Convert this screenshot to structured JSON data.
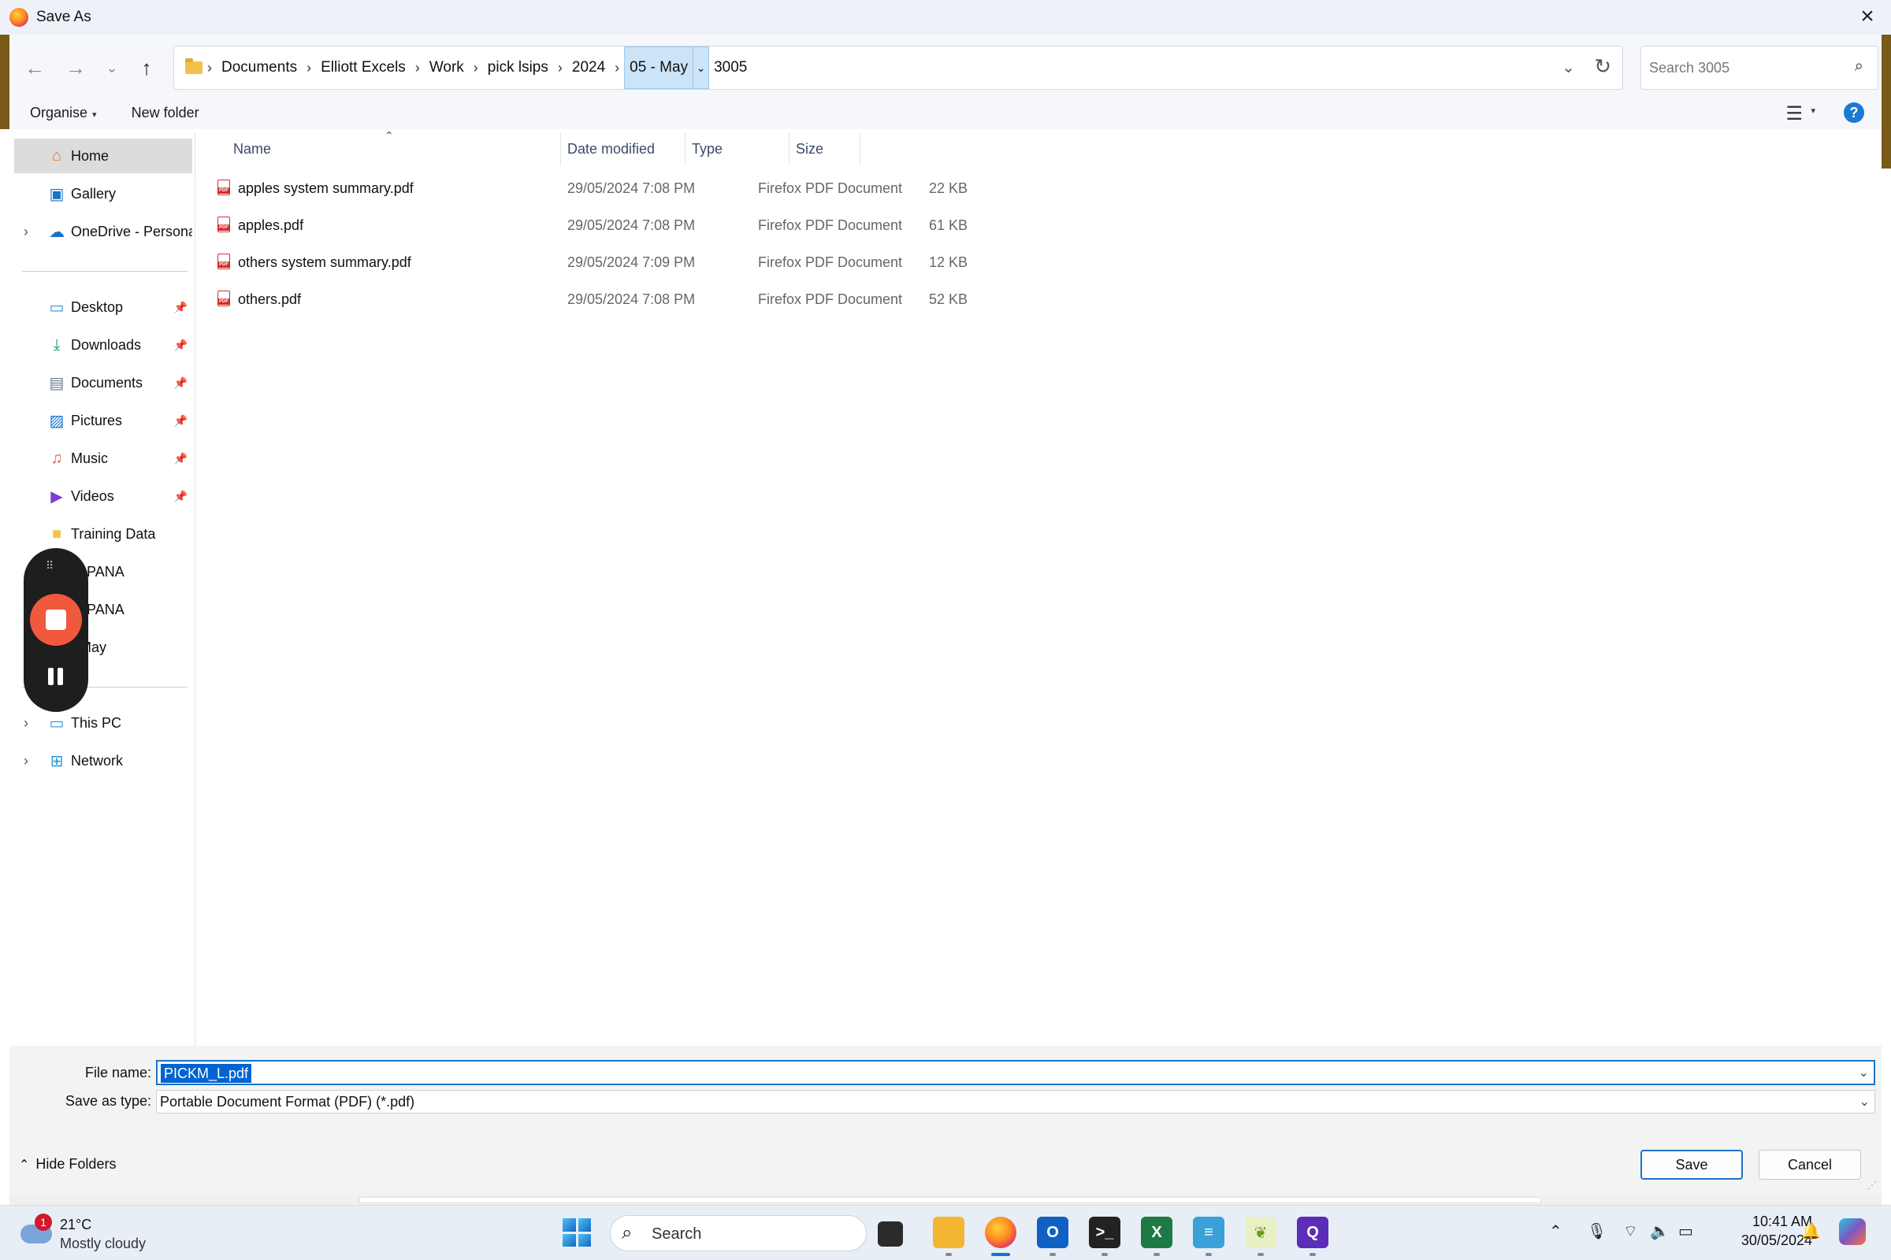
{
  "window": {
    "title": "Save As"
  },
  "address": {
    "crumbs": [
      "Documents",
      "Elliott Excels",
      "Work",
      "pick lsips",
      "2024"
    ],
    "selected_crumb": "05 - May",
    "tail": "3005"
  },
  "search": {
    "placeholder": "Search 3005"
  },
  "toolbar": {
    "organise_label": "Organise",
    "new_folder_label": "New folder"
  },
  "sidebar": {
    "items": [
      {
        "label": "Home"
      },
      {
        "label": "Gallery"
      },
      {
        "label": "OneDrive - Persona"
      },
      {
        "label": "Desktop"
      },
      {
        "label": "Downloads"
      },
      {
        "label": "Documents"
      },
      {
        "label": "Pictures"
      },
      {
        "label": "Music"
      },
      {
        "label": "Videos"
      },
      {
        "label": "Training Data"
      },
      {
        "label": "1_PANA"
      },
      {
        "label": "2_PANA"
      },
      {
        "label": "- May"
      },
      {
        "label": "This PC"
      },
      {
        "label": "Network"
      }
    ]
  },
  "columns": {
    "name": "Name",
    "date": "Date modified",
    "type": "Type",
    "size": "Size"
  },
  "files": [
    {
      "name": "apples system summary.pdf",
      "date": "29/05/2024 7:08 PM",
      "type": "Firefox PDF Document",
      "size": "22 KB"
    },
    {
      "name": "apples.pdf",
      "date": "29/05/2024 7:08 PM",
      "type": "Firefox PDF Document",
      "size": "61 KB"
    },
    {
      "name": "others system summary.pdf",
      "date": "29/05/2024 7:09 PM",
      "type": "Firefox PDF Document",
      "size": "12 KB"
    },
    {
      "name": "others.pdf",
      "date": "29/05/2024 7:08 PM",
      "type": "Firefox PDF Document",
      "size": "52 KB"
    }
  ],
  "form": {
    "file_name_label": "File name:",
    "file_name_value": "PICKM_L.pdf",
    "save_type_label": "Save as type:",
    "save_type_value": "Portable Document Format (PDF) (*.pdf)",
    "hide_folders_label": "Hide Folders",
    "save_label": "Save",
    "cancel_label": "Cancel"
  },
  "taskbar": {
    "weather_badge": "1",
    "temperature": "21°C",
    "condition": "Mostly cloudy",
    "search_label": "Search",
    "time": "10:41 AM",
    "date": "30/05/2024"
  },
  "colors": {
    "accent": "#1a73c8",
    "selection": "#0063d1",
    "recorder_stop": "#f0593e"
  }
}
